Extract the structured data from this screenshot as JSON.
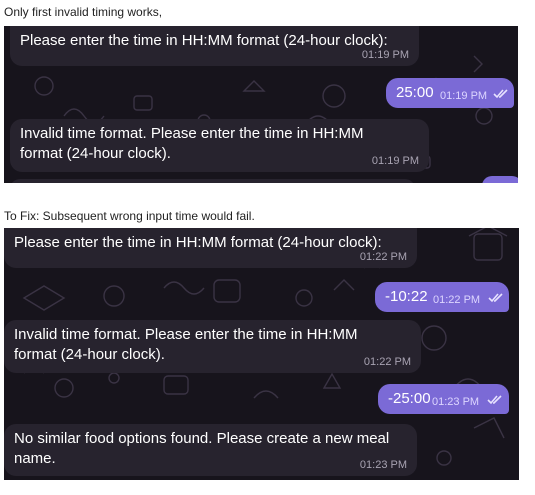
{
  "captions": {
    "first": "Only first invalid timing works,",
    "second": "To Fix: Subsequent wrong input time would fail."
  },
  "colors": {
    "chat_background": "#17141c",
    "incoming_bubble": "#27232e",
    "outgoing_bubble": "#7b6ad6",
    "timestamp": "#a8a3b2"
  },
  "screenshot1": {
    "messages": [
      {
        "direction": "incoming",
        "text": "Please enter the time in HH:MM format (24-hour clock):",
        "time": "01:19 PM"
      },
      {
        "direction": "outgoing",
        "text": "25:00",
        "time": "01:19 PM",
        "status_icon": "double-check-icon"
      },
      {
        "direction": "incoming",
        "text": "Invalid time format. Please enter the time in HH:MM format (24-hour clock).",
        "time": "01:19 PM"
      }
    ]
  },
  "screenshot2": {
    "messages": [
      {
        "direction": "incoming",
        "text": "Please enter the time in HH:MM format (24-hour clock):",
        "time": "01:22 PM"
      },
      {
        "direction": "outgoing",
        "text": "-10:22",
        "time": "01:22 PM",
        "status_icon": "double-check-icon"
      },
      {
        "direction": "incoming",
        "text": "Invalid time format. Please enter the time in HH:MM format (24-hour clock).",
        "time": "01:22 PM"
      },
      {
        "direction": "outgoing",
        "text": "-25:00",
        "time": "01:23 PM",
        "status_icon": "double-check-icon"
      },
      {
        "direction": "incoming",
        "text": "No similar food options found. Please create a new meal name.",
        "time": "01:23 PM"
      }
    ]
  }
}
